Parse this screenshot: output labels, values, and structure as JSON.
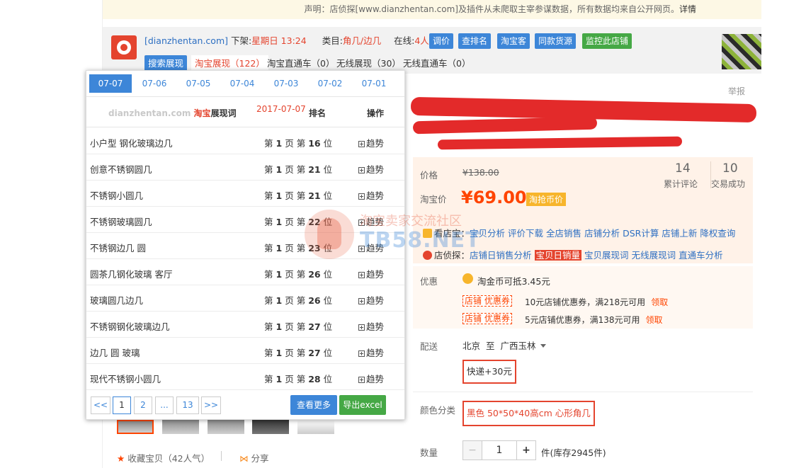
{
  "notice": {
    "text": "声明：店侦探[www.dianzhentan.com]及插件从未爬取主宰参谋数据，所有数据均来自公开网页。",
    "detail": "详情"
  },
  "plugin": {
    "site": "[dianzhentan.com]",
    "listed_label": "下架:",
    "listed_value": "星期日 13:24",
    "category_label": "类目:",
    "category_value": "角几/边几",
    "online_label": "在线:",
    "online_value": "4人",
    "buttons": [
      "调价",
      "查排名",
      "淘宝客",
      "同款货源"
    ],
    "monitor_button": "监控此店铺",
    "tabs": {
      "search": "搜索展现",
      "taobao": "淘宝展现（122）",
      "tbdirect": "淘宝直通车（0）",
      "wireless": "无线展现（30）",
      "wirelessdirect": "无线直通车（0）"
    }
  },
  "popup": {
    "dates": [
      "07-07",
      "07-06",
      "07-05",
      "07-04",
      "07-03",
      "07-02",
      "07-01"
    ],
    "brand_site": "dianzhentan.com",
    "brand_tb": "淘宝",
    "brand_word": "展现词",
    "date": "2017-07-07",
    "rank_header": "排名",
    "op_header": "操作",
    "rows": [
      {
        "keyword": "小户型 钢化玻璃边几",
        "page": "1",
        "pos": "16"
      },
      {
        "keyword": "创意不锈钢圆几",
        "page": "1",
        "pos": "21"
      },
      {
        "keyword": "不锈钢小圆几",
        "page": "1",
        "pos": "21"
      },
      {
        "keyword": "不锈钢玻璃圆几",
        "page": "1",
        "pos": "22"
      },
      {
        "keyword": "不锈钢边几 圆",
        "page": "1",
        "pos": "23"
      },
      {
        "keyword": "圆茶几钢化玻璃 客厅",
        "page": "1",
        "pos": "26"
      },
      {
        "keyword": "玻璃圆几边几",
        "page": "1",
        "pos": "26"
      },
      {
        "keyword": "不锈钢钢化玻璃边几",
        "page": "1",
        "pos": "27"
      },
      {
        "keyword": "边几 圆 玻璃",
        "page": "1",
        "pos": "27"
      },
      {
        "keyword": "现代不锈钢小圆几",
        "page": "1",
        "pos": "28"
      }
    ],
    "rank_prefix": "第",
    "rank_page_unit": "页",
    "rank_pos_prefix": "第",
    "rank_pos_unit": "位",
    "trend_label": "趋势",
    "pager": [
      "<<",
      "1",
      "2",
      "...",
      "13",
      ">>"
    ],
    "more_button": "查看更多",
    "excel_button": "导出excel"
  },
  "product": {
    "report": "举报",
    "price_label": "价格",
    "price_old": "¥138.00",
    "taobao_price_label": "淘宝价",
    "price_now": "¥69.00",
    "coin_badge": "淘抢币价",
    "reviews_count": "14",
    "reviews_label": "累计评论",
    "deals_count": "10",
    "deals_label": "交易成功",
    "kandian_label": "看店宝：",
    "kandian_links": [
      "宝贝分析",
      "评价下载",
      "全店销售",
      "店铺分析",
      "DSR计算",
      "店铺上新",
      "降权查询"
    ],
    "dzt_label": "店侦探：",
    "dzt_links": [
      "店铺日销售分析",
      "宝贝日销量",
      "宝贝展现词",
      "无线展现词",
      "直通车分析"
    ],
    "promo_label": "优惠",
    "coin_text": "淘金币可抵3.45元",
    "coupon_tag": "店铺 优惠券",
    "coupon1": "10元店铺优惠券，满218元可用",
    "coupon2": "5元店铺优惠券，满138元可用",
    "claim": "领取",
    "ship_label": "配送",
    "ship_from": "北京",
    "ship_to_word": "至",
    "ship_to": "广西玉林",
    "express": "快递+30元",
    "color_label": "颜色分类",
    "color_value": "黑色 50*50*40高cm 心形角几",
    "qty_label": "数量",
    "qty_minus": "−",
    "qty_value": "1",
    "qty_plus": "+",
    "stock": "件(库存2945件)",
    "fav": "收藏宝贝（42人气）",
    "share": "分享"
  },
  "watermark": {
    "cn": "淘宝卖家交流社区",
    "en": "TB58.NET"
  },
  "colors": {
    "accent_blue": "#3d86d8",
    "accent_green": "#45a845",
    "taobao_orange": "#ff4400",
    "brand_red": "#e4442e"
  }
}
